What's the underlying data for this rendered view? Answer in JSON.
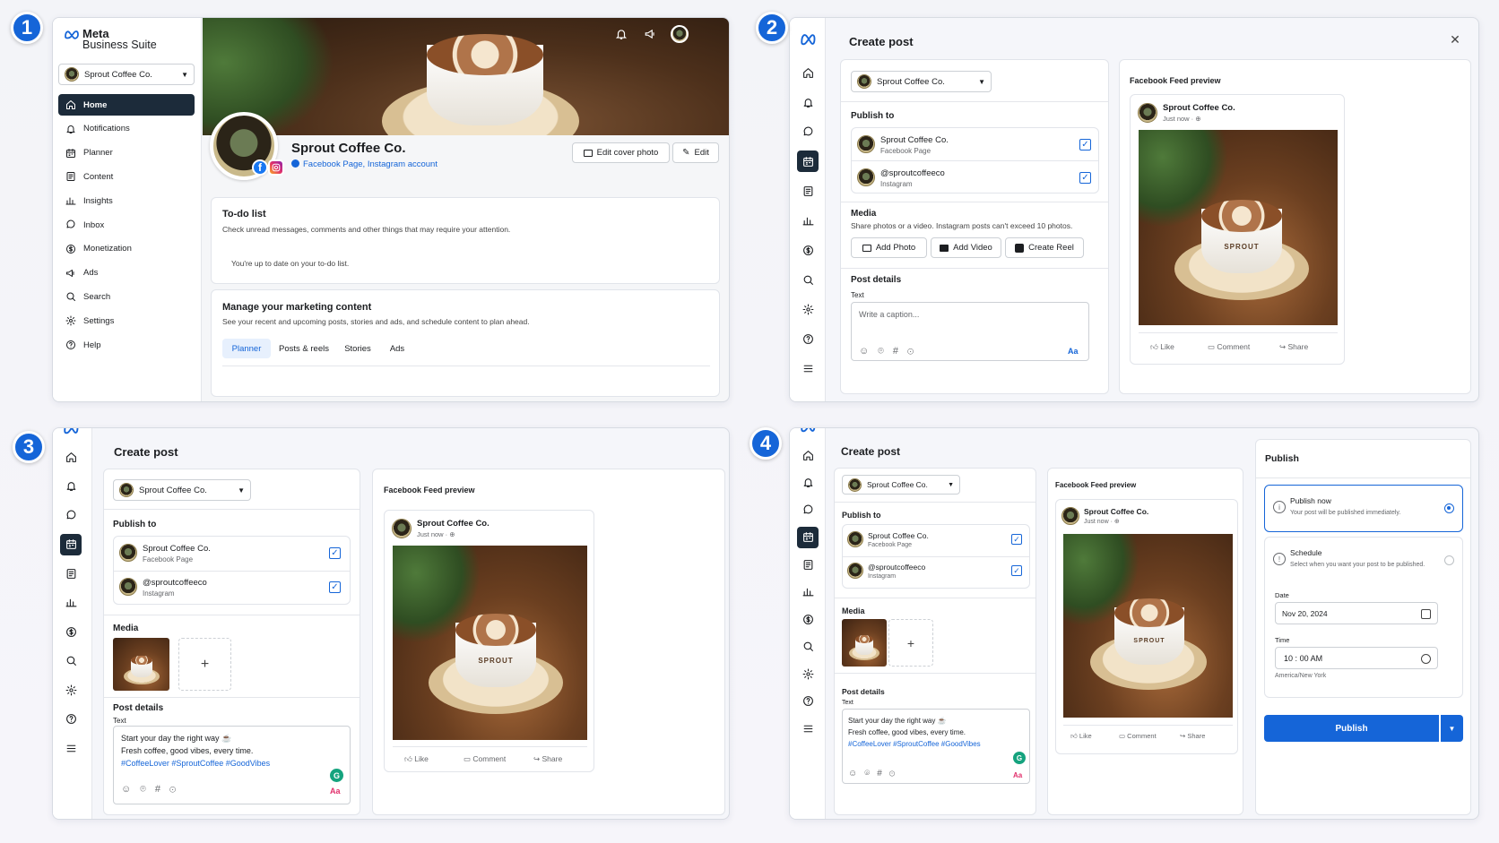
{
  "colors": {
    "accent": "#1565d8",
    "nav_active": "#1c2b3a",
    "badge": "#1565d8",
    "grammarly": "#15a37e",
    "instagram": "#e1306c"
  },
  "badges": [
    "1",
    "2",
    "3",
    "4"
  ],
  "brand": {
    "line1": "Meta",
    "line2": "Business Suite"
  },
  "account": {
    "name": "Sprout Coffee Co.",
    "ig_handle": "@sproutcoffeeco",
    "fb_type": "Facebook Page",
    "ig_type": "Instagram"
  },
  "panel1": {
    "nav": [
      {
        "label": "Home",
        "icon": "home-icon",
        "active": true
      },
      {
        "label": "Notifications",
        "icon": "bell-icon"
      },
      {
        "label": "Planner",
        "icon": "calendar-icon"
      },
      {
        "label": "Content",
        "icon": "content-icon"
      },
      {
        "label": "Insights",
        "icon": "bar-chart-icon"
      },
      {
        "label": "Inbox",
        "icon": "chat-icon"
      },
      {
        "label": "Monetization",
        "icon": "dollar-icon"
      },
      {
        "label": "Ads",
        "icon": "megaphone-icon"
      },
      {
        "label": "Search",
        "icon": "search-icon"
      },
      {
        "label": "Settings",
        "icon": "gear-icon"
      },
      {
        "label": "Help",
        "icon": "help-icon"
      }
    ],
    "page_links_fb": "Facebook Page",
    "page_links_sep": ", ",
    "page_links_ig": "Instagram account",
    "edit_cover": "Edit cover photo",
    "edit": "Edit",
    "todo_title": "To-do list",
    "todo_desc": "Check unread messages, comments and other things that may require your attention.",
    "todo_status": "You're up to date on your to-do list.",
    "manage_title": "Manage your marketing content",
    "manage_desc": "See your recent and upcoming posts, stories and ads, and schedule content to plan ahead.",
    "tabs": [
      "Planner",
      "Posts & reels",
      "Stories",
      "Ads"
    ]
  },
  "create": {
    "title": "Create post",
    "publish_to": "Publish to",
    "media": "Media",
    "media_desc": "Share photos or a video. Instagram posts can't exceed 10 photos.",
    "add_photo": "Add Photo",
    "add_video": "Add Video",
    "create_reel": "Create Reel",
    "post_details": "Post details",
    "text_label": "Text",
    "caption_placeholder": "Write a caption...",
    "caption_lines": [
      "Start your day the right way ☕",
      "Fresh coffee, good vibes, every time.",
      "#CoffeeLover #SproutCoffee #GoodVibes"
    ],
    "add_plus": "+",
    "aa": "Aa",
    "grammarly": "G"
  },
  "preview": {
    "title": "Facebook Feed preview",
    "time": "Just now · ",
    "like": "Like",
    "comment": "Comment",
    "share": "Share",
    "cup_brand": "SPROUT"
  },
  "publish": {
    "title": "Publish",
    "now_label": "Publish now",
    "now_desc": "Your post will be published immediately.",
    "schedule_label": "Schedule",
    "schedule_desc": "Select when you want your post to be published.",
    "date_label": "Date",
    "date_value": "Nov 20, 2024",
    "time_label": "Time",
    "time_hour": "10",
    "time_colon": ":",
    "time_min": "00",
    "time_ampm": "AM",
    "timezone": "America/New York",
    "button": "Publish",
    "selected": "Publish now"
  }
}
